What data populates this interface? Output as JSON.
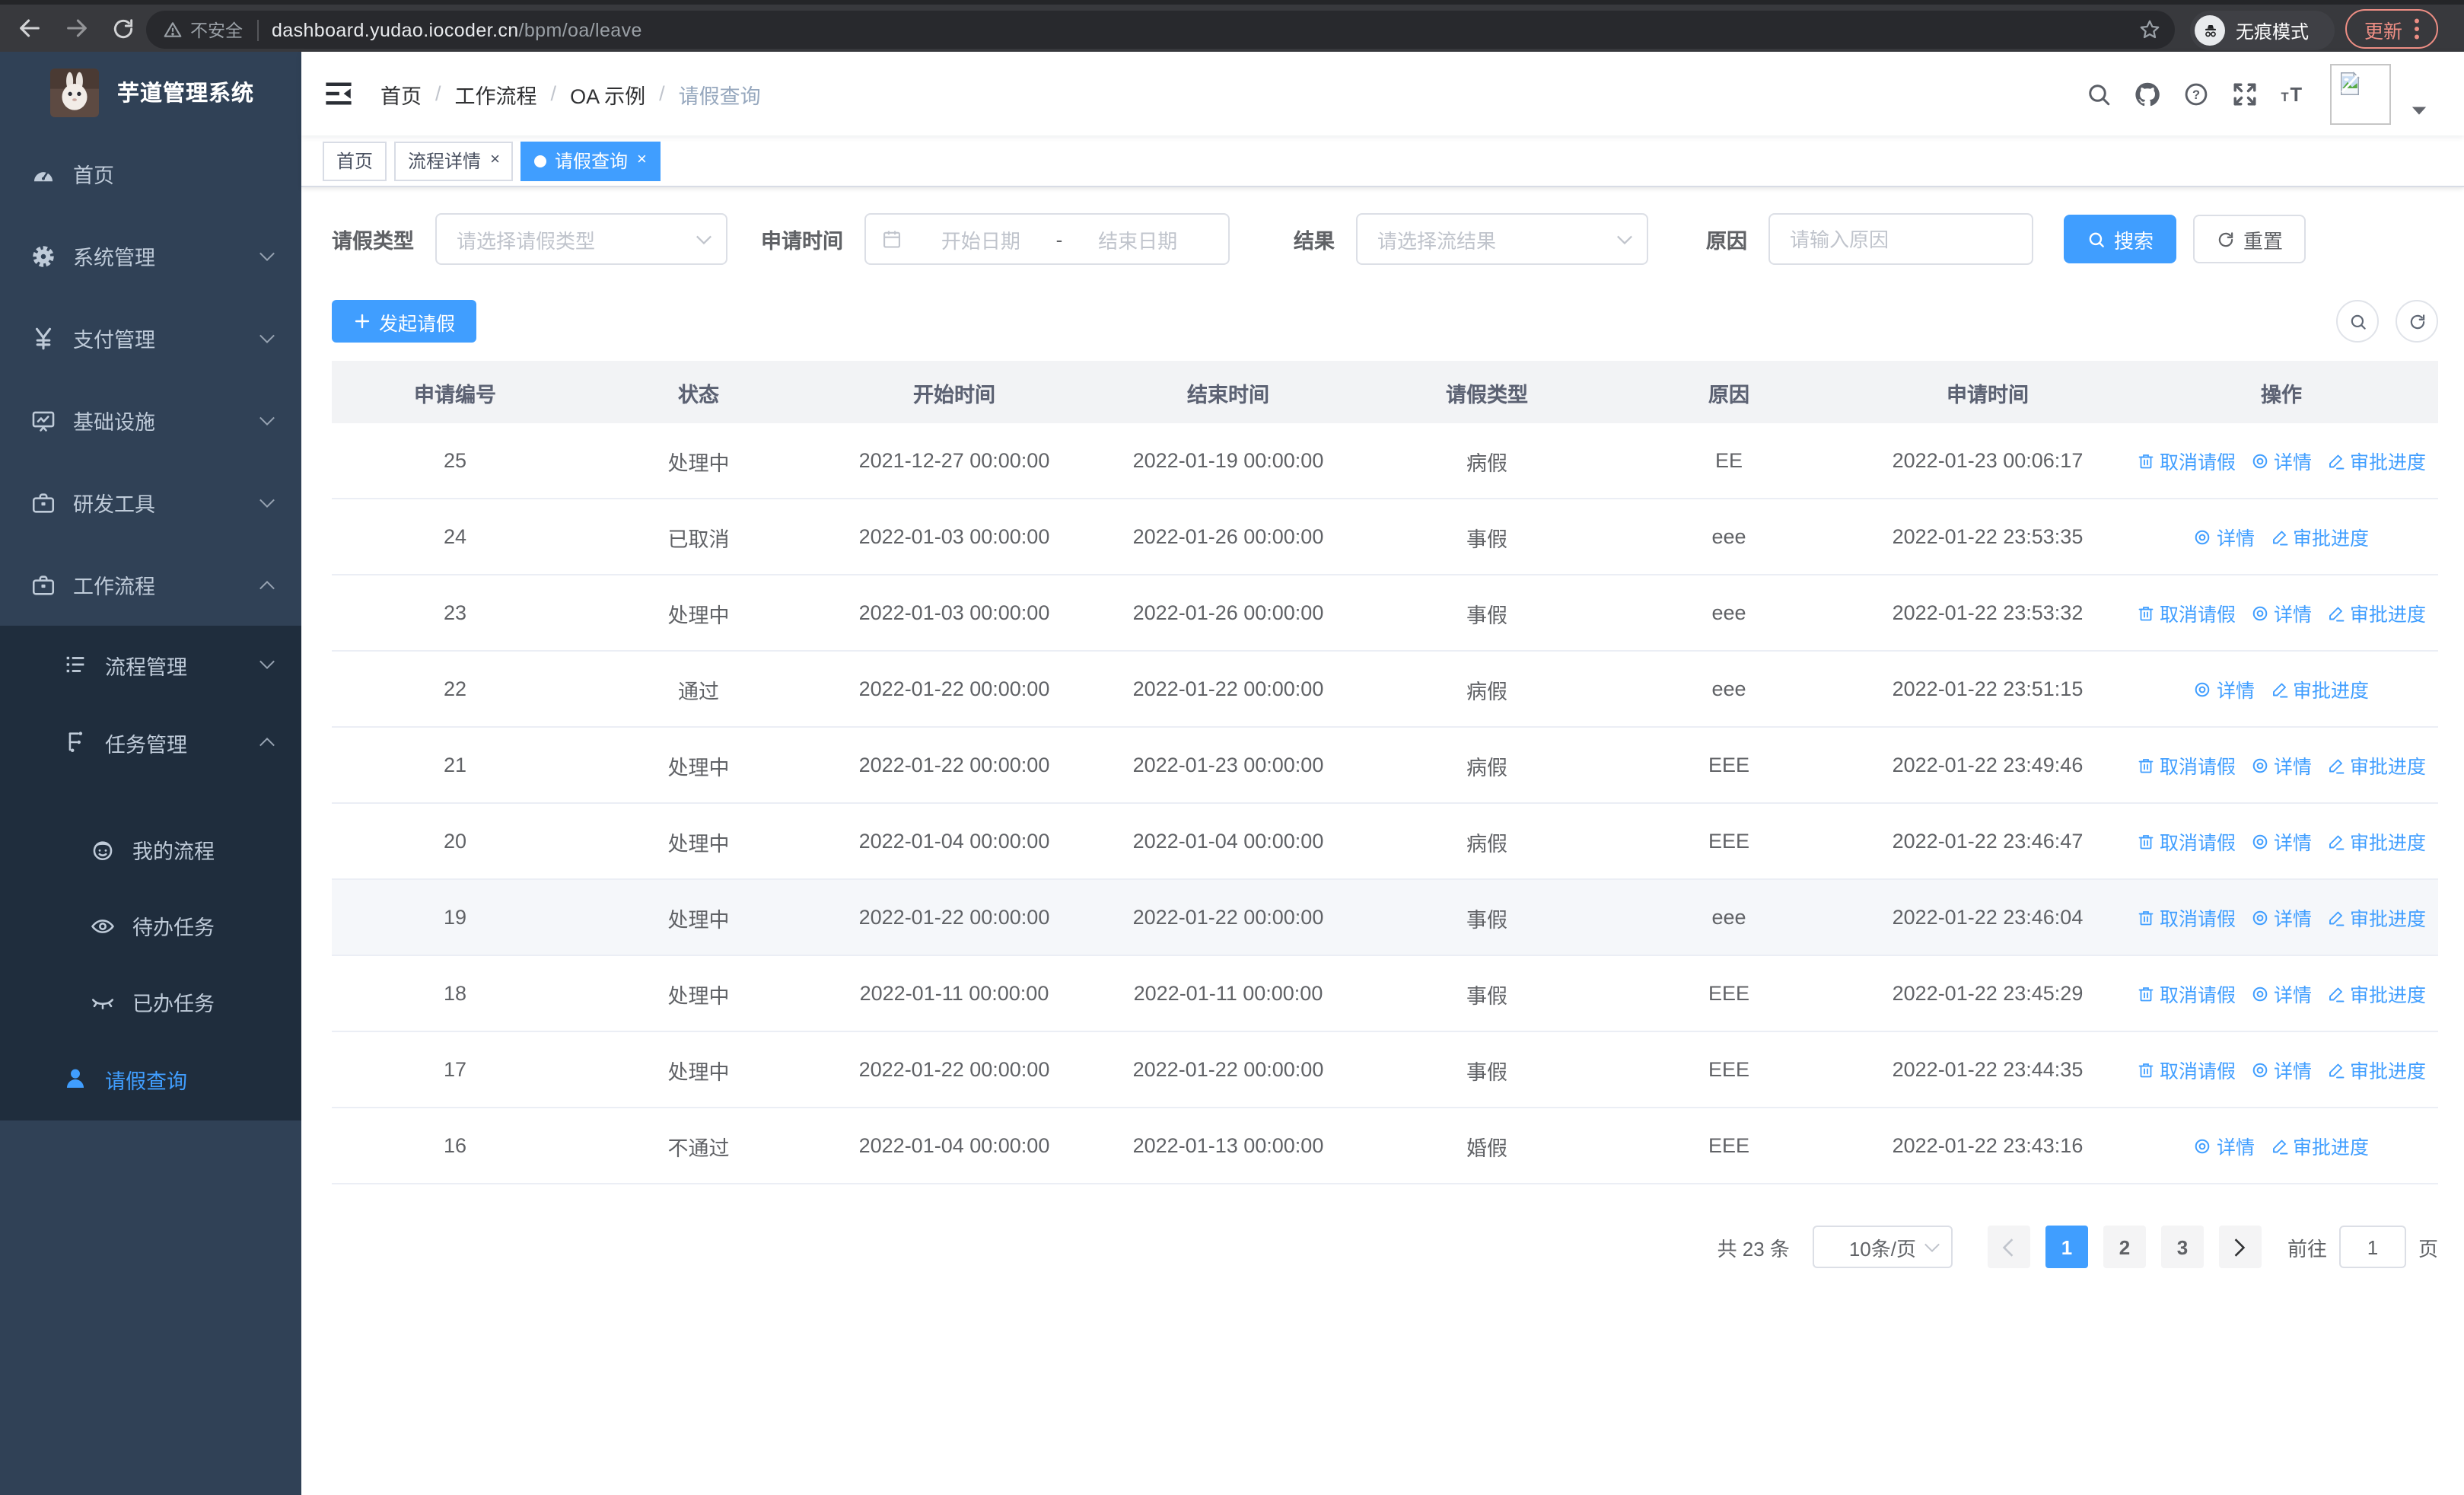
{
  "colors": {
    "accent": "#409eff",
    "sidebar_bg": "#304156",
    "submenu_bg": "#1f2d3d",
    "update": "#ee8e84"
  },
  "browser": {
    "security_warning": "不安全",
    "url_host": "dashboard.yudao.iocoder.cn",
    "url_path": "/bpm/oa/leave",
    "incognito_label": "无痕模式",
    "update_label": "更新"
  },
  "sidebar": {
    "title": "芋道管理系统",
    "menu": [
      {
        "key": "home",
        "label": "首页",
        "icon": "dashboard",
        "level": 1
      },
      {
        "key": "system",
        "label": "系统管理",
        "icon": "gear",
        "level": 1,
        "chevron": "down"
      },
      {
        "key": "payment",
        "label": "支付管理",
        "icon": "yen",
        "level": 1,
        "chevron": "down"
      },
      {
        "key": "infrastructure",
        "label": "基础设施",
        "icon": "monitor",
        "level": 1,
        "chevron": "down"
      },
      {
        "key": "devtools",
        "label": "研发工具",
        "icon": "toolbox",
        "level": 1,
        "chevron": "down"
      },
      {
        "key": "workflow",
        "label": "工作流程",
        "icon": "toolbox",
        "level": 1,
        "chevron": "up"
      },
      {
        "key": "process-management",
        "label": "流程管理",
        "icon": "list",
        "level": 2,
        "chevron": "down",
        "group": "sub"
      },
      {
        "key": "task-management",
        "label": "任务管理",
        "icon": "tree",
        "level": 2,
        "chevron": "up",
        "group": "sub"
      },
      {
        "key": "my-process",
        "label": "我的流程",
        "icon": "face",
        "level": 3,
        "group": "sub",
        "gap": true
      },
      {
        "key": "todo-task",
        "label": "待办任务",
        "icon": "eye-open",
        "level": 3,
        "group": "sub"
      },
      {
        "key": "done-task",
        "label": "已办任务",
        "icon": "eye-closed",
        "level": 3,
        "group": "sub"
      },
      {
        "key": "leave-query",
        "label": "请假查询",
        "icon": "user",
        "level": 2,
        "group": "sub",
        "active": true
      }
    ]
  },
  "header": {
    "breadcrumb": [
      "首页",
      "工作流程",
      "OA 示例",
      "请假查询"
    ]
  },
  "tabs": [
    {
      "label": "首页",
      "closable": false,
      "active": false
    },
    {
      "label": "流程详情",
      "closable": true,
      "active": false
    },
    {
      "label": "请假查询",
      "closable": true,
      "active": true
    }
  ],
  "filters": {
    "leave_type": {
      "label": "请假类型",
      "placeholder": "请选择请假类型"
    },
    "apply_time": {
      "label": "申请时间",
      "start_placeholder": "开始日期",
      "separator": "-",
      "end_placeholder": "结束日期"
    },
    "result": {
      "label": "结果",
      "placeholder": "请选择流结果"
    },
    "reason": {
      "label": "原因",
      "placeholder": "请输入原因"
    },
    "search_label": "搜索",
    "reset_label": "重置"
  },
  "toolbar": {
    "create_label": "发起请假"
  },
  "table": {
    "columns": [
      "申请编号",
      "状态",
      "开始时间",
      "结束时间",
      "请假类型",
      "原因",
      "申请时间",
      "操作"
    ],
    "action_labels": {
      "cancel": "取消请假",
      "detail": "详情",
      "progress": "审批进度"
    },
    "rows": [
      {
        "id": "25",
        "status": "处理中",
        "start": "2021-12-27 00:00:00",
        "end": "2022-01-19 00:00:00",
        "type": "病假",
        "reason": "EE",
        "applied": "2022-01-23 00:06:17",
        "actions": [
          "cancel",
          "detail",
          "progress"
        ],
        "highlight": false
      },
      {
        "id": "24",
        "status": "已取消",
        "start": "2022-01-03 00:00:00",
        "end": "2022-01-26 00:00:00",
        "type": "事假",
        "reason": "eee",
        "applied": "2022-01-22 23:53:35",
        "actions": [
          "detail",
          "progress"
        ],
        "highlight": false
      },
      {
        "id": "23",
        "status": "处理中",
        "start": "2022-01-03 00:00:00",
        "end": "2022-01-26 00:00:00",
        "type": "事假",
        "reason": "eee",
        "applied": "2022-01-22 23:53:32",
        "actions": [
          "cancel",
          "detail",
          "progress"
        ],
        "highlight": false
      },
      {
        "id": "22",
        "status": "通过",
        "start": "2022-01-22 00:00:00",
        "end": "2022-01-22 00:00:00",
        "type": "病假",
        "reason": "eee",
        "applied": "2022-01-22 23:51:15",
        "actions": [
          "detail",
          "progress"
        ],
        "highlight": false
      },
      {
        "id": "21",
        "status": "处理中",
        "start": "2022-01-22 00:00:00",
        "end": "2022-01-23 00:00:00",
        "type": "病假",
        "reason": "EEE",
        "applied": "2022-01-22 23:49:46",
        "actions": [
          "cancel",
          "detail",
          "progress"
        ],
        "highlight": false
      },
      {
        "id": "20",
        "status": "处理中",
        "start": "2022-01-04 00:00:00",
        "end": "2022-01-04 00:00:00",
        "type": "病假",
        "reason": "EEE",
        "applied": "2022-01-22 23:46:47",
        "actions": [
          "cancel",
          "detail",
          "progress"
        ],
        "highlight": false
      },
      {
        "id": "19",
        "status": "处理中",
        "start": "2022-01-22 00:00:00",
        "end": "2022-01-22 00:00:00",
        "type": "事假",
        "reason": "eee",
        "applied": "2022-01-22 23:46:04",
        "actions": [
          "cancel",
          "detail",
          "progress"
        ],
        "highlight": true
      },
      {
        "id": "18",
        "status": "处理中",
        "start": "2022-01-11 00:00:00",
        "end": "2022-01-11 00:00:00",
        "type": "事假",
        "reason": "EEE",
        "applied": "2022-01-22 23:45:29",
        "actions": [
          "cancel",
          "detail",
          "progress"
        ],
        "highlight": false
      },
      {
        "id": "17",
        "status": "处理中",
        "start": "2022-01-22 00:00:00",
        "end": "2022-01-22 00:00:00",
        "type": "事假",
        "reason": "EEE",
        "applied": "2022-01-22 23:44:35",
        "actions": [
          "cancel",
          "detail",
          "progress"
        ],
        "highlight": false
      },
      {
        "id": "16",
        "status": "不通过",
        "start": "2022-01-04 00:00:00",
        "end": "2022-01-13 00:00:00",
        "type": "婚假",
        "reason": "EEE",
        "applied": "2022-01-22 23:43:16",
        "actions": [
          "detail",
          "progress"
        ],
        "highlight": false
      }
    ]
  },
  "pagination": {
    "total_text": "共 23 条",
    "page_size": "10条/页",
    "pages": [
      "1",
      "2",
      "3"
    ],
    "active_page": "1",
    "goto_label": "前往",
    "goto_value": "1",
    "page_unit": "页"
  }
}
